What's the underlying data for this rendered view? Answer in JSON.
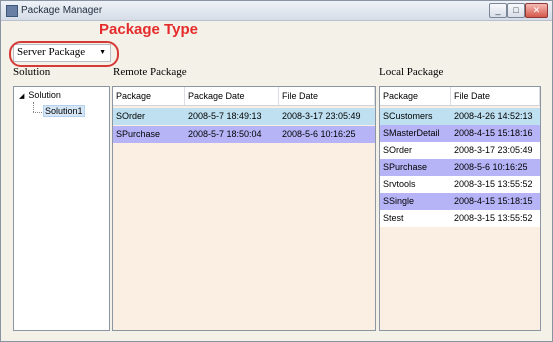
{
  "window": {
    "title": "Package Manager",
    "minimize": "_",
    "maximize": "□",
    "close": "✕"
  },
  "annotation": "Package Type",
  "combo": {
    "value": "Server Package"
  },
  "labels": {
    "solution": "Solution",
    "remote": "Remote Package",
    "local": "Local Package"
  },
  "tree": {
    "root": "Solution",
    "child": "Solution1"
  },
  "colors": {
    "row_blue": "#bee0f0",
    "row_purple": "#b6b4f7",
    "row_white": "#ffffff",
    "grid_bg": "#fbefe3",
    "annotation": "#e52c2c"
  },
  "remote": {
    "headers": [
      "Package",
      "Package Date",
      "File Date"
    ],
    "rows": [
      {
        "cells": [
          "SOrder",
          "2008-5-7 18:49:13",
          "2008-3-17 23:05:49"
        ],
        "color": "#bee0f0"
      },
      {
        "cells": [
          "SPurchase",
          "2008-5-7 18:50:04",
          "2008-5-6 10:16:25"
        ],
        "color": "#b6b4f7"
      }
    ]
  },
  "local": {
    "headers": [
      "Package",
      "File Date"
    ],
    "rows": [
      {
        "cells": [
          "SCustomers",
          "2008-4-26 14:52:13"
        ],
        "color": "#bee0f0"
      },
      {
        "cells": [
          "SMasterDetail",
          "2008-4-15 15:18:16"
        ],
        "color": "#b6b4f7"
      },
      {
        "cells": [
          "SOrder",
          "2008-3-17 23:05:49"
        ],
        "color": "#ffffff"
      },
      {
        "cells": [
          "SPurchase",
          "2008-5-6 10:16:25"
        ],
        "color": "#b6b4f7"
      },
      {
        "cells": [
          "Srvtools",
          "2008-3-15 13:55:52"
        ],
        "color": "#ffffff"
      },
      {
        "cells": [
          "SSingle",
          "2008-4-15 15:18:15"
        ],
        "color": "#b6b4f7"
      },
      {
        "cells": [
          "Stest",
          "2008-3-15 13:55:52"
        ],
        "color": "#ffffff"
      }
    ]
  }
}
